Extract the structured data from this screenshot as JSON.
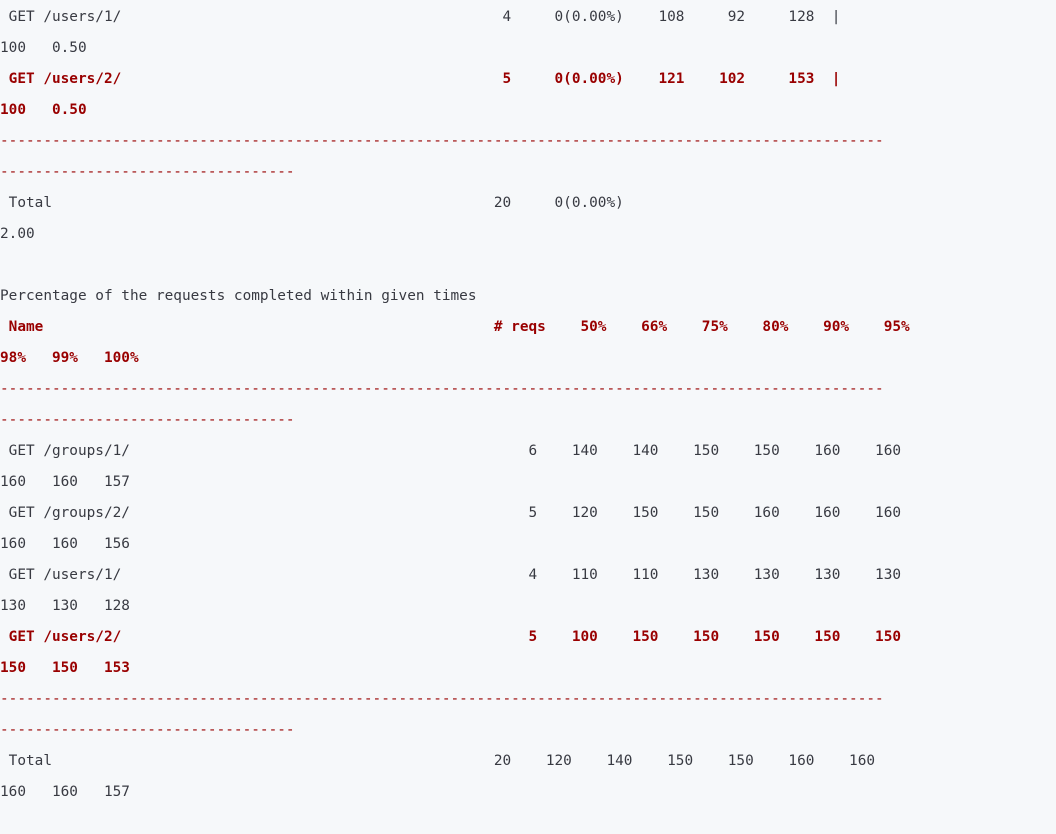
{
  "lines": [
    " GET /users/1/                                            4     0(0.00%)    108     92     128  |",
    "100   0.50",
    " GET /users/2/                                            5     0(0.00%)    121    102     153  |",
    "100   0.50",
    "------------------------------------------------------------------------------------------------------",
    "----------------------------------",
    " Total                                                   20     0(0.00%)",
    "2.00",
    "",
    "Percentage of the requests completed within given times",
    " Name                                                    # reqs    50%    66%    75%    80%    90%    95%",
    "98%   99%   100%",
    "------------------------------------------------------------------------------------------------------",
    "----------------------------------",
    " GET /groups/1/                                              6    140    140    150    150    160    160",
    "160   160   157",
    " GET /groups/2/                                              5    120    150    150    160    160    160",
    "160   160   156",
    " GET /users/1/                                               4    110    110    130    130    130    130",
    "130   130   128",
    " GET /users/2/                                               5    100    150    150    150    150    150",
    "150   150   153",
    "------------------------------------------------------------------------------------------------------",
    "----------------------------------",
    " Total                                                   20    120    140    150    150    160    160",
    "160   160   157"
  ]
}
